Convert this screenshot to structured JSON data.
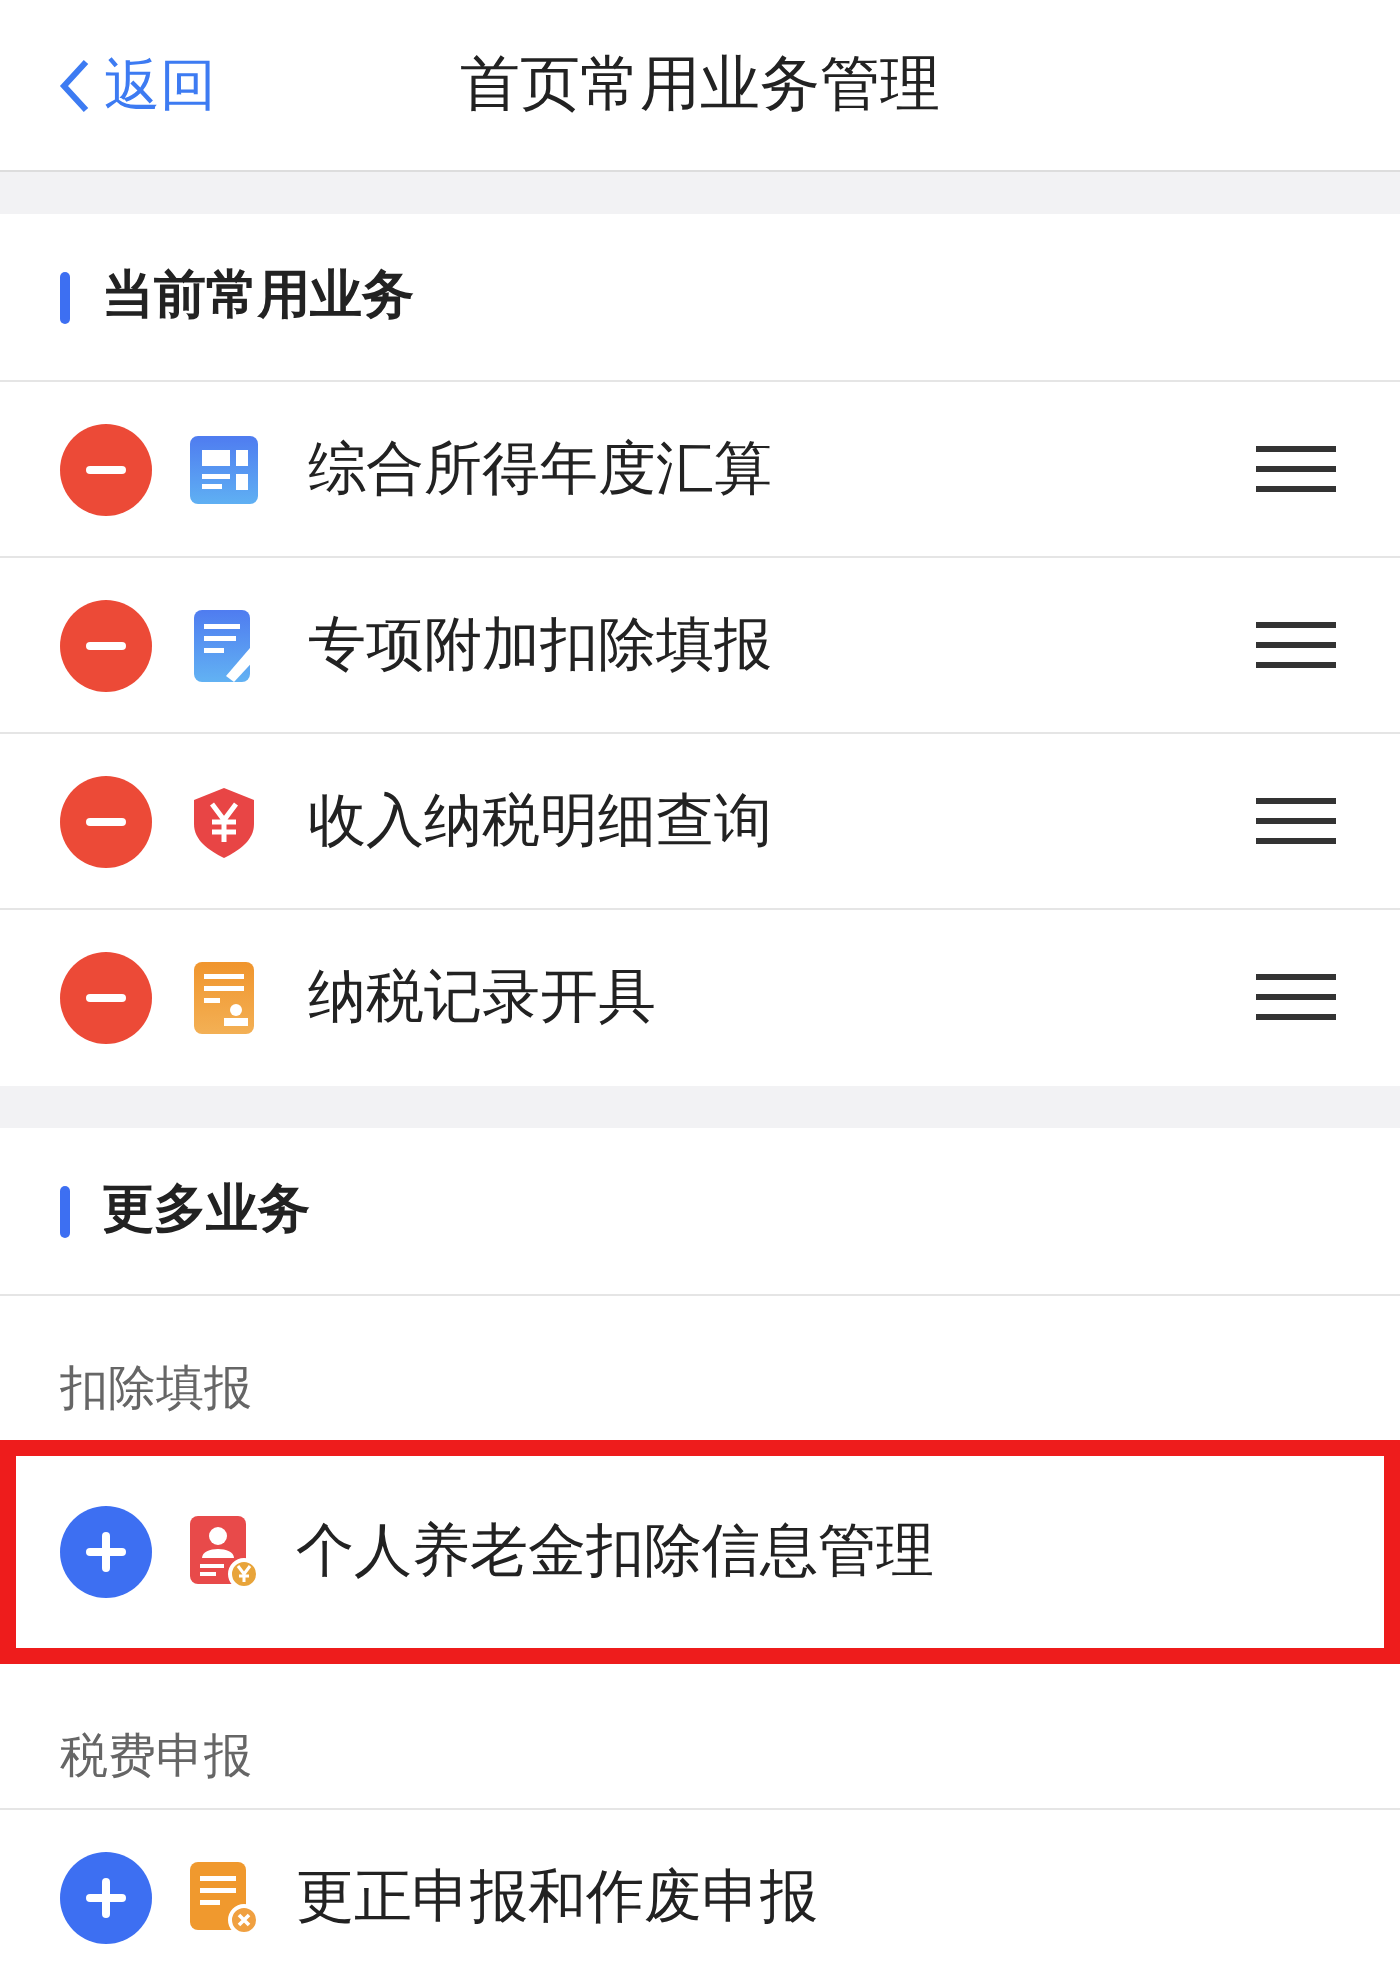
{
  "nav": {
    "back": "返回",
    "title": "首页常用业务管理"
  },
  "current": {
    "title": "当前常用业务",
    "items": [
      {
        "label": "综合所得年度汇算",
        "kind": "grid"
      },
      {
        "label": "专项附加扣除填报",
        "kind": "edit"
      },
      {
        "label": "收入纳税明细查询",
        "kind": "shield"
      },
      {
        "label": "纳税记录开具",
        "kind": "stamp"
      }
    ]
  },
  "more": {
    "title": "更多业务",
    "groups": [
      {
        "label": "扣除填报",
        "items": [
          {
            "label": "个人养老金扣除信息管理",
            "kind": "person",
            "highlighted": true
          }
        ]
      },
      {
        "label": "税费申报",
        "items": [
          {
            "label": "更正申报和作废申报",
            "kind": "cancel",
            "highlighted": false
          }
        ]
      }
    ]
  }
}
